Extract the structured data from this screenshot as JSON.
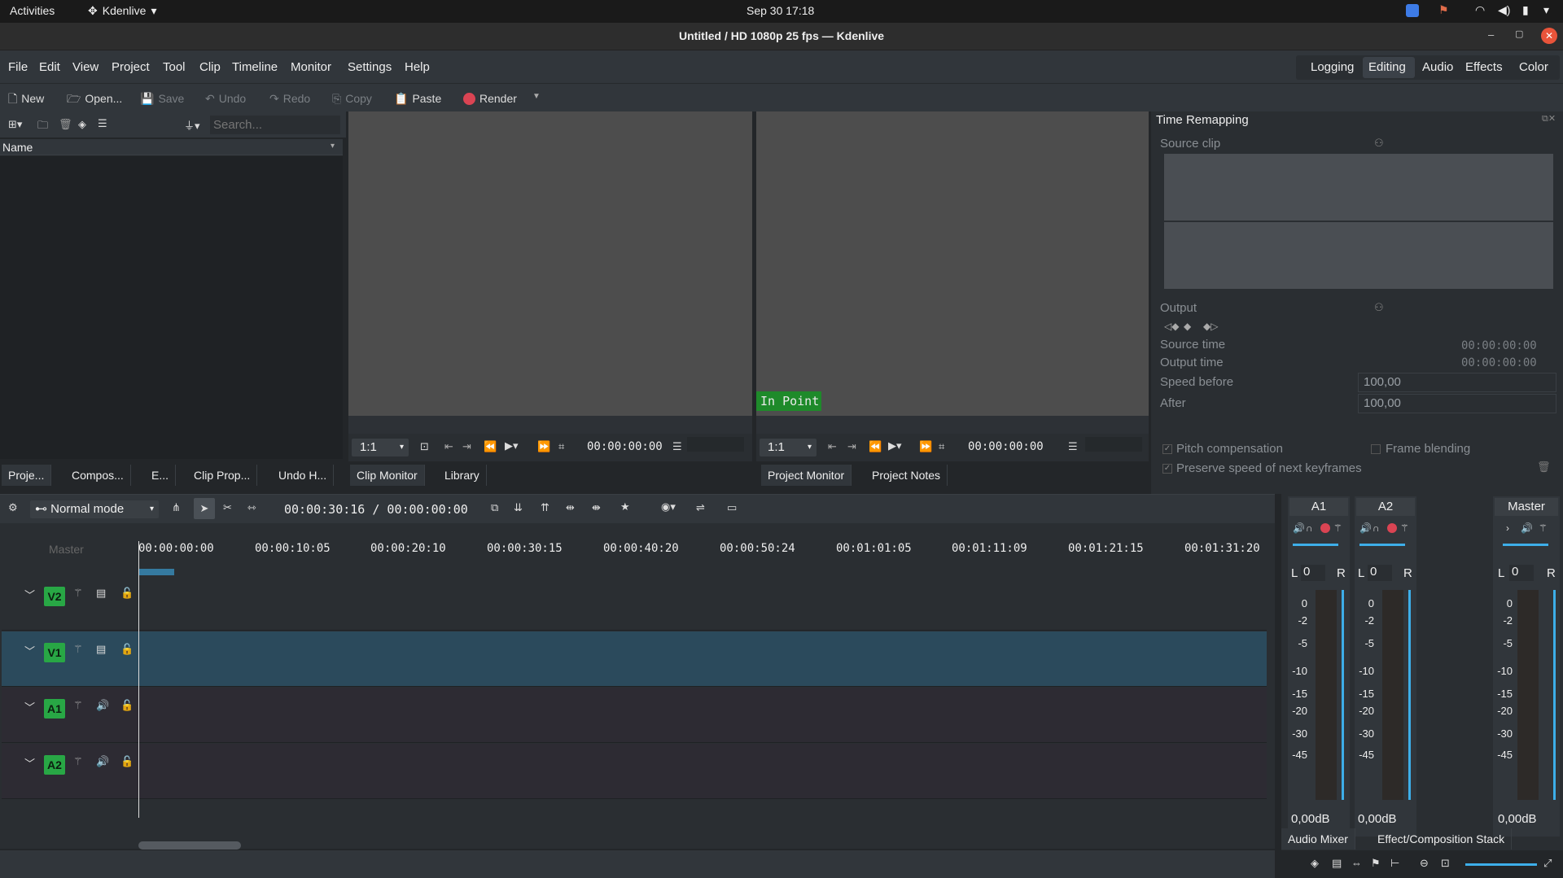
{
  "gnome": {
    "activities": "Activities",
    "app_name": "Kdenlive",
    "clock": "Sep 30  17:18"
  },
  "window": {
    "title": "Untitled / HD 1080p 25 fps — Kdenlive"
  },
  "menu": [
    "File",
    "Edit",
    "View",
    "Project",
    "Tool",
    "Clip",
    "Timeline",
    "Monitor",
    "Settings",
    "Help"
  ],
  "layouts": [
    "Logging",
    "Editing",
    "Audio",
    "Effects",
    "Color"
  ],
  "layouts_active": "Editing",
  "toolbar": {
    "new": "New",
    "open": "Open...",
    "save": "Save",
    "undo": "Undo",
    "redo": "Redo",
    "copy": "Copy",
    "paste": "Paste",
    "render": "Render"
  },
  "bin": {
    "search_placeholder": "Search...",
    "column_name": "Name"
  },
  "left_tabs": [
    "Proje...",
    "Compos...",
    "E...",
    "Clip Prop...",
    "Undo H..."
  ],
  "clip_monitor": {
    "zoom": "1:1",
    "timecode": "00:00:00:00",
    "tabs": [
      "Clip Monitor",
      "Library"
    ]
  },
  "project_monitor": {
    "zoom": "1:1",
    "timecode": "00:00:00:00",
    "overlay": "In Point",
    "tabs": [
      "Project Monitor",
      "Project Notes"
    ]
  },
  "time_remapping": {
    "title": "Time Remapping",
    "source_clip": "Source clip",
    "output": "Output",
    "source_time_label": "Source time",
    "source_time": "00:00:00:00",
    "output_time_label": "Output time",
    "output_time": "00:00:00:00",
    "speed_before_label": "Speed before",
    "speed_before": "100,00",
    "after_label": "After",
    "after": "100,00",
    "pitch_compensation": "Pitch compensation",
    "frame_blending": "Frame blending",
    "preserve_speed": "Preserve speed of next keyframes"
  },
  "timeline": {
    "mode": "Normal mode",
    "position": "00:00:30:16 / 00:00:00:00",
    "master_label": "Master",
    "ruler": [
      "00:00:00:00",
      "00:00:10:05",
      "00:00:20:10",
      "00:00:30:15",
      "00:00:40:20",
      "00:00:50:24",
      "00:01:01:05",
      "00:01:11:09",
      "00:01:21:15",
      "00:01:31:20"
    ],
    "tracks": [
      "V2",
      "V1",
      "A1",
      "A2"
    ]
  },
  "mixer": {
    "channels": [
      {
        "name": "A1",
        "pan": "0",
        "level": "0,00dB"
      },
      {
        "name": "A2",
        "pan": "0",
        "level": "0,00dB"
      },
      {
        "name": "Master",
        "pan": "0",
        "level": "0,00dB"
      }
    ],
    "scale": [
      "0",
      "-2",
      "-5",
      "-10",
      "-15",
      "-20",
      "-30",
      "-45"
    ],
    "left": "L",
    "right": "R",
    "tabs": [
      "Audio Mixer",
      "Effect/Composition Stack"
    ]
  },
  "colors": {
    "accent": "#3daee9",
    "track_tag": "#28a745",
    "selected_track": "#2b4a5c",
    "record": "#da4453"
  }
}
